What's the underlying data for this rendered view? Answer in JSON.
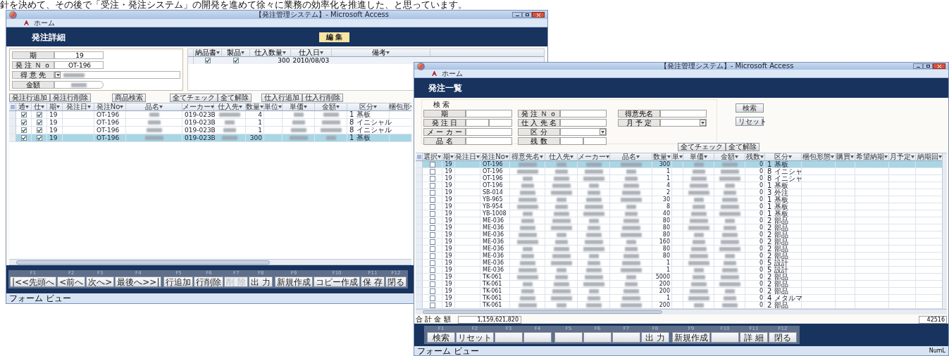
{
  "article_text": "針を決めて、その後で「受注・発注システム」の開発を進めて徐々に業務の効率化を推進した、と思っています。",
  "detail_window": {
    "title": "【発注管理システム】- Microsoft Access",
    "ribbon_tab": "ホーム",
    "form_title": "発注詳細",
    "edit_button": "編 集",
    "fields": [
      {
        "label": "期",
        "kind": "text",
        "value": "19"
      },
      {
        "label": "発 注 Ｎ ｏ",
        "kind": "text",
        "value": "OT-196"
      },
      {
        "label": "得 意 先",
        "kind": "combo"
      },
      {
        "label": "金額",
        "kind": "blurred"
      }
    ],
    "receipts": {
      "columns": [
        "納品書",
        "製品",
        "仕入数量",
        "仕入日",
        "備考"
      ],
      "rows": [
        {
          "delivered": true,
          "product": true,
          "quantity": "300",
          "date": "2010/08/03"
        }
      ]
    },
    "order_buttons": [
      "発注行追加",
      "発注行削除",
      "商品検索",
      "全てチェック",
      "全て解除"
    ],
    "receipt_buttons": [
      "仕入行追加",
      "仕入行削除"
    ],
    "grid": {
      "columns": [
        {
          "label": "通",
          "kind": "check"
        },
        {
          "label": "仕",
          "kind": "check"
        },
        {
          "label": "期",
          "kind": "text"
        },
        {
          "label": "発注日",
          "kind": "text"
        },
        {
          "label": "発注No",
          "kind": "text"
        },
        {
          "label": "品名",
          "kind": "blurred"
        },
        {
          "label": "メーカー",
          "kind": "text"
        },
        {
          "label": "仕入先",
          "kind": "blurred"
        },
        {
          "label": "数量",
          "kind": "number"
        },
        {
          "label": "単位",
          "kind": "text"
        },
        {
          "label": "単価",
          "kind": "blurred"
        },
        {
          "label": "金額",
          "kind": "blurred"
        },
        {
          "label": "区分",
          "kind": "text"
        },
        {
          "label": "梱包形",
          "kind": "text"
        }
      ],
      "rows": [
        {
          "selected": false,
          "cells": [
            true,
            true,
            "19",
            null,
            "OT-196",
            null,
            "019-023B",
            null,
            "4",
            null,
            null,
            null,
            "1 基板",
            null
          ]
        },
        {
          "selected": false,
          "cells": [
            true,
            true,
            "19",
            null,
            "OT-196",
            null,
            "019-023B",
            null,
            "1",
            null,
            null,
            null,
            "8 イニシャル",
            null
          ]
        },
        {
          "selected": false,
          "cells": [
            true,
            true,
            "19",
            null,
            "OT-196",
            null,
            "019-023B",
            null,
            "1",
            null,
            null,
            null,
            "8 イニシャル",
            null
          ]
        },
        {
          "selected": true,
          "cells": [
            true,
            true,
            "19",
            null,
            "OT-196",
            null,
            "019-023B",
            null,
            "300",
            null,
            null,
            null,
            "1 基板",
            null
          ]
        }
      ]
    },
    "footer": [
      {
        "fkey": "F1",
        "label": "|<<先頭へ",
        "disabled": false
      },
      {
        "fkey": "F2",
        "label": "<前へ",
        "disabled": false
      },
      {
        "fkey": "F3",
        "label": "次へ>",
        "disabled": false
      },
      {
        "fkey": "F4",
        "label": "最後へ>>|",
        "disabled": false
      },
      {
        "fkey": "F5",
        "label": "行追加",
        "disabled": false
      },
      {
        "fkey": "F6",
        "label": "行削除",
        "disabled": false
      },
      {
        "fkey": "F7",
        "label": "削 除",
        "disabled": true
      },
      {
        "fkey": "F8",
        "label": "出 力",
        "disabled": false
      },
      {
        "fkey": "F9",
        "label": "新規作成",
        "disabled": false
      },
      {
        "fkey": "F10",
        "label": "コピー作成",
        "disabled": false
      },
      {
        "fkey": "F11",
        "label": "保 存",
        "disabled": false
      },
      {
        "fkey": "F12",
        "label": "閉る",
        "disabled": false
      }
    ],
    "status": "フォーム ビュー"
  },
  "list_window": {
    "title": "【発注管理システム】- Microsoft Access",
    "ribbon_tab": "ホーム",
    "form_title": "発注一覧",
    "search_label": "検 索",
    "search_rows": [
      [
        {
          "label": "期",
          "kind": "text"
        },
        {
          "label": "発 注 Ｎ ｏ",
          "kind": "text"
        },
        {
          "label": "得意先名",
          "kind": "text"
        }
      ],
      [
        {
          "label": "発 注 日",
          "kind": "range"
        },
        {
          "label": "仕 入 先 名",
          "kind": "text"
        },
        {
          "label": "月 予 定",
          "kind": "combo"
        }
      ],
      [
        {
          "label": "メ ー カ ー",
          "kind": "text"
        },
        {
          "label": "区 分",
          "kind": "combo"
        }
      ],
      [
        {
          "label": "品 名",
          "kind": "text"
        },
        {
          "label": "残 数",
          "kind": "range"
        }
      ]
    ],
    "search_buttons": [
      "検索",
      "リセット"
    ],
    "check_buttons": [
      "全てチェック",
      "全て解除"
    ],
    "grid": {
      "columns": [
        {
          "label": "選択",
          "kind": "check"
        },
        {
          "label": "期",
          "kind": "text"
        },
        {
          "label": "発注日",
          "kind": "text"
        },
        {
          "label": "発注No",
          "kind": "text"
        },
        {
          "label": "得意先名",
          "kind": "blurred"
        },
        {
          "label": "仕入先",
          "kind": "blurred"
        },
        {
          "label": "メーカー",
          "kind": "blurred"
        },
        {
          "label": "品名",
          "kind": "blurred"
        },
        {
          "label": "数量",
          "kind": "number"
        },
        {
          "label": "単",
          "kind": "text"
        },
        {
          "label": "単価",
          "kind": "blurred"
        },
        {
          "label": "金額",
          "kind": "blurred"
        },
        {
          "label": "残数",
          "kind": "number"
        },
        {
          "label": "区分",
          "kind": "text"
        },
        {
          "label": "梱包形態",
          "kind": "text"
        },
        {
          "label": "購買",
          "kind": "text"
        },
        {
          "label": "希望納期",
          "kind": "text"
        },
        {
          "label": "月予定",
          "kind": "text"
        },
        {
          "label": "納期回",
          "kind": "text"
        }
      ],
      "rows": [
        {
          "selected": true,
          "cells": [
            false,
            "19",
            null,
            "OT-196",
            null,
            null,
            null,
            null,
            "300",
            null,
            null,
            null,
            "0",
            "1 基板",
            null,
            null,
            null,
            null,
            null
          ]
        },
        {
          "selected": false,
          "cells": [
            false,
            "19",
            null,
            "OT-196",
            null,
            null,
            null,
            null,
            "1",
            null,
            null,
            null,
            "0",
            "8 イニシャ",
            null,
            null,
            null,
            null,
            null
          ]
        },
        {
          "selected": false,
          "cells": [
            false,
            "19",
            null,
            "OT-196",
            null,
            null,
            null,
            null,
            "1",
            null,
            null,
            null,
            "0",
            "8 イニシャ",
            null,
            null,
            null,
            null,
            null
          ]
        },
        {
          "selected": false,
          "cells": [
            false,
            "19",
            null,
            "OT-196",
            null,
            null,
            null,
            null,
            "4",
            null,
            null,
            null,
            "0",
            "1 基板",
            null,
            null,
            null,
            null,
            null
          ]
        },
        {
          "selected": false,
          "cells": [
            false,
            "19",
            null,
            "SB-014",
            null,
            null,
            null,
            null,
            "2",
            null,
            null,
            null,
            "0",
            "3 外注",
            null,
            null,
            null,
            null,
            null
          ]
        },
        {
          "selected": false,
          "cells": [
            false,
            "19",
            null,
            "YB-965",
            null,
            null,
            null,
            null,
            "30",
            null,
            null,
            null,
            "0",
            "1 基板",
            null,
            null,
            null,
            null,
            null
          ]
        },
        {
          "selected": false,
          "cells": [
            false,
            "19",
            null,
            "YB-954",
            null,
            null,
            null,
            null,
            "8",
            null,
            null,
            null,
            "0",
            "1 基板",
            null,
            null,
            null,
            null,
            null
          ]
        },
        {
          "selected": false,
          "cells": [
            false,
            "19",
            null,
            "YB-1008",
            null,
            null,
            null,
            null,
            "40",
            null,
            null,
            null,
            "0",
            "1 基板",
            null,
            null,
            null,
            null,
            null
          ]
        },
        {
          "selected": false,
          "cells": [
            false,
            "19",
            null,
            "ME-036",
            null,
            null,
            null,
            null,
            "80",
            null,
            null,
            null,
            "0",
            "2 部品",
            null,
            null,
            null,
            null,
            null
          ]
        },
        {
          "selected": false,
          "cells": [
            false,
            "19",
            null,
            "ME-036",
            null,
            null,
            null,
            null,
            "80",
            null,
            null,
            null,
            "0",
            "2 部品",
            null,
            null,
            null,
            null,
            null
          ]
        },
        {
          "selected": false,
          "cells": [
            false,
            "19",
            null,
            "ME-036",
            null,
            null,
            null,
            null,
            "80",
            null,
            null,
            null,
            "0",
            "2 部品",
            null,
            null,
            null,
            null,
            null
          ]
        },
        {
          "selected": false,
          "cells": [
            false,
            "19",
            null,
            "ME-036",
            null,
            null,
            null,
            null,
            "160",
            null,
            null,
            null,
            "0",
            "2 部品",
            null,
            null,
            null,
            null,
            null
          ]
        },
        {
          "selected": false,
          "cells": [
            false,
            "19",
            null,
            "ME-036",
            null,
            null,
            null,
            null,
            "80",
            null,
            null,
            null,
            "0",
            "2 部品",
            null,
            null,
            null,
            null,
            null
          ]
        },
        {
          "selected": false,
          "cells": [
            false,
            "19",
            null,
            "ME-036",
            null,
            null,
            null,
            null,
            "80",
            null,
            null,
            null,
            "0",
            "2 部品",
            null,
            null,
            null,
            null,
            null
          ]
        },
        {
          "selected": false,
          "cells": [
            false,
            "19",
            null,
            "ME-036",
            null,
            null,
            null,
            null,
            "1",
            null,
            null,
            null,
            "0",
            "5 設計",
            null,
            null,
            null,
            null,
            null
          ]
        },
        {
          "selected": false,
          "cells": [
            false,
            "19",
            null,
            "ME-036",
            null,
            null,
            null,
            null,
            "1",
            null,
            null,
            null,
            "0",
            "5 設計",
            null,
            null,
            null,
            null,
            null
          ]
        },
        {
          "selected": false,
          "cells": [
            false,
            "19",
            null,
            "TK-061",
            null,
            null,
            null,
            null,
            "5000",
            null,
            null,
            null,
            "0",
            "2 部品",
            null,
            null,
            null,
            null,
            null
          ]
        },
        {
          "selected": false,
          "cells": [
            false,
            "19",
            null,
            "TK-061",
            null,
            null,
            null,
            null,
            "200",
            null,
            null,
            null,
            "0",
            "2 部品",
            null,
            null,
            null,
            null,
            null
          ]
        },
        {
          "selected": false,
          "cells": [
            false,
            "19",
            null,
            "TK-061",
            null,
            null,
            null,
            null,
            "200",
            null,
            null,
            null,
            "0",
            "2 部品",
            null,
            null,
            null,
            null,
            null
          ]
        },
        {
          "selected": false,
          "cells": [
            false,
            "19",
            null,
            "TK-061",
            null,
            null,
            null,
            null,
            "1",
            null,
            null,
            null,
            "0",
            "4 メタルマ",
            null,
            null,
            null,
            null,
            null
          ]
        },
        {
          "selected": false,
          "cells": [
            false,
            "19",
            null,
            "TK-061",
            null,
            null,
            null,
            null,
            "200",
            null,
            null,
            null,
            "0",
            "2 部品",
            null,
            null,
            null,
            null,
            null
          ]
        }
      ]
    },
    "total_label": "合 計 金 額",
    "total_value": "1,159,621,820",
    "record_count": "42516",
    "footer": [
      {
        "fkey": "F1",
        "label": "検索"
      },
      {
        "fkey": "F2",
        "label": "リセット"
      },
      {
        "fkey": "F3"
      },
      {
        "fkey": "F4"
      },
      {
        "fkey": "F5"
      },
      {
        "fkey": "F6"
      },
      {
        "fkey": "F7"
      },
      {
        "fkey": "F8",
        "label": "出 力"
      },
      {
        "fkey": "F9",
        "label": "新規作成"
      },
      {
        "fkey": "F10"
      },
      {
        "fkey": "F11",
        "label": "詳 細"
      },
      {
        "fkey": "F12",
        "label": "閉る"
      }
    ],
    "status": "フォーム ビュー",
    "status_right": "NumL"
  }
}
